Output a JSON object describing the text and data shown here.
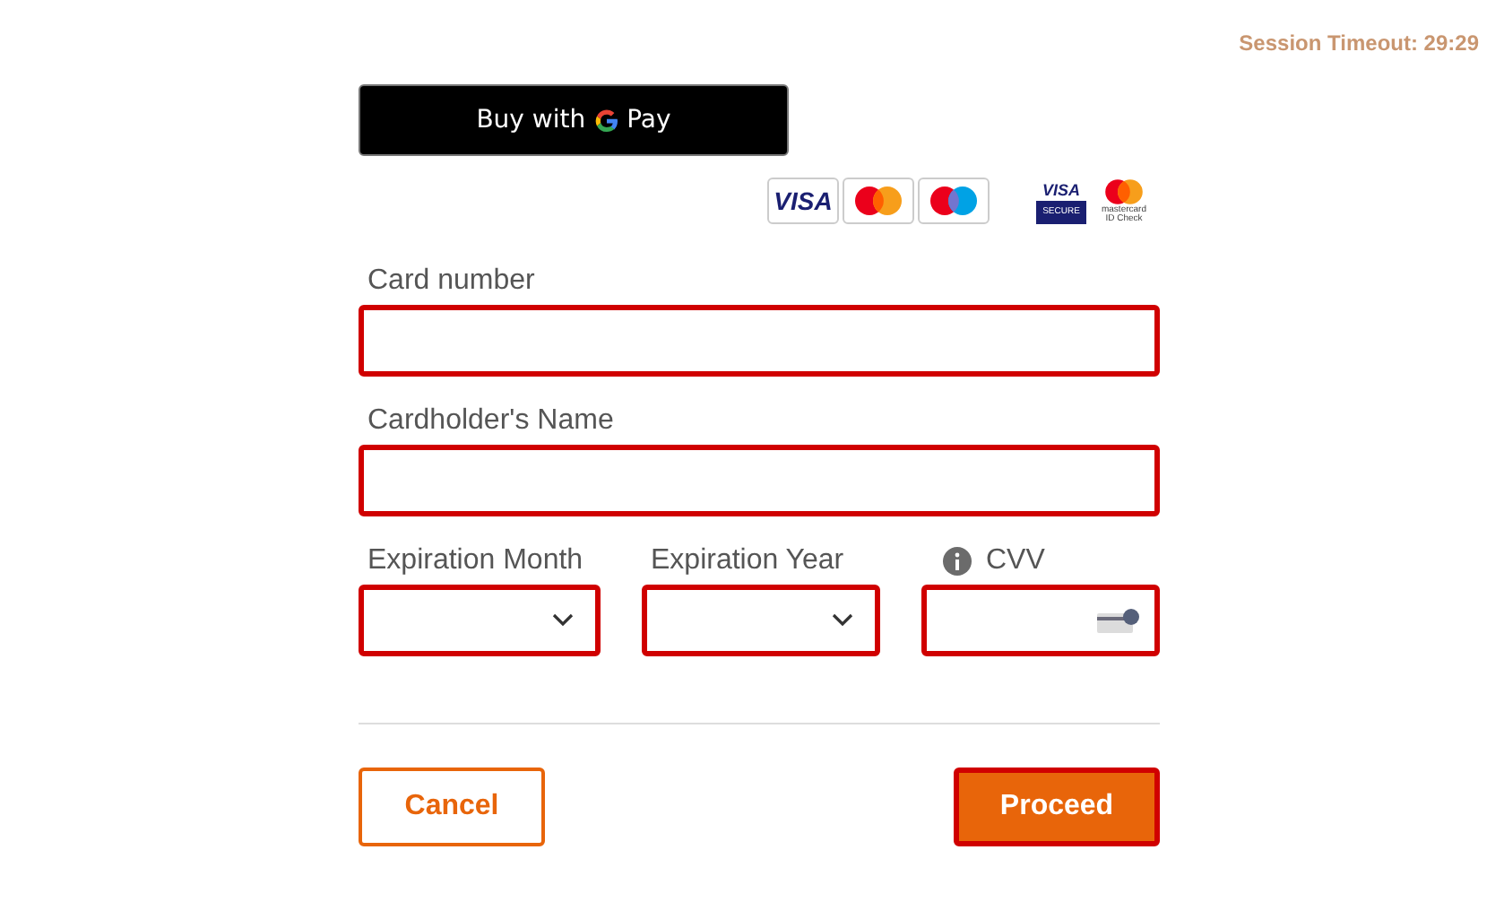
{
  "session_timeout": "Session Timeout: 29:29",
  "gpay_button": {
    "prefix": "Buy with",
    "suffix": "Pay"
  },
  "card_logos": [
    {
      "kind": "visa",
      "text": "VISA"
    },
    {
      "kind": "mastercard"
    },
    {
      "kind": "maestro"
    },
    {
      "kind": "visa_secure",
      "text": "VISA",
      "subtext": "SECURE"
    },
    {
      "kind": "id_check",
      "text": "mastercard",
      "subtext": "ID Check"
    }
  ],
  "rows": [
    {
      "fields": [
        {
          "kind": "text",
          "label": "Card number",
          "invalid": true
        }
      ]
    },
    {
      "fields": [
        {
          "kind": "text",
          "label": "Cardholder's Name",
          "invalid": true
        }
      ]
    },
    {
      "fields": [
        {
          "kind": "select",
          "label": "Expiration Month",
          "invalid": true
        },
        {
          "kind": "select",
          "label": "Expiration Year",
          "invalid": true
        },
        {
          "kind": "cvv",
          "label": "CVV",
          "invalid": true
        }
      ]
    }
  ],
  "buttons": [
    {
      "kind": "secondary",
      "label": "Cancel",
      "focused": false
    },
    {
      "kind": "primary",
      "label": "Proceed",
      "focused": true
    }
  ]
}
